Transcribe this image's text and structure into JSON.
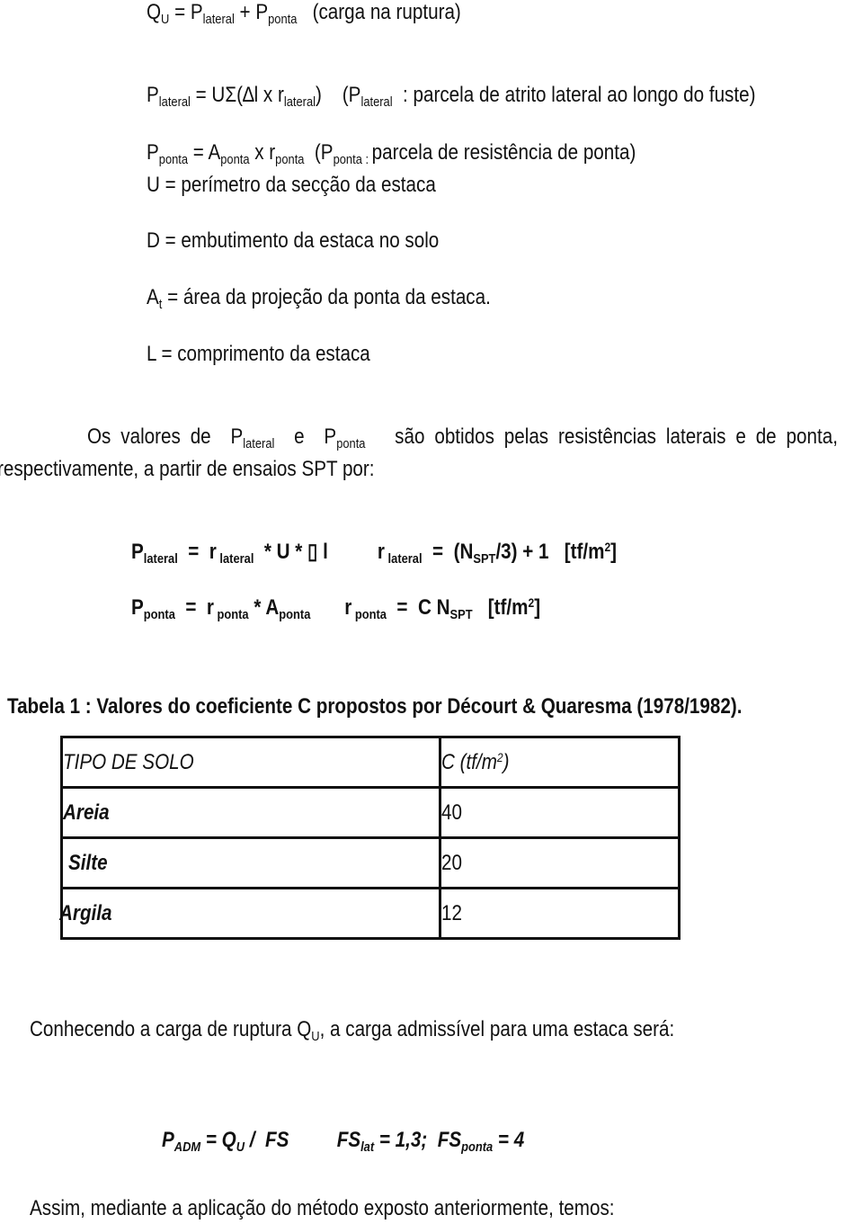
{
  "lines": {
    "qu": {
      "lhs": "Q",
      "lhs_sub": "U",
      "eq": " = P",
      "sub1": "lateral",
      "plus": " +  P",
      "sub2": "ponta",
      "note": "   (carga na ruptura)"
    },
    "plateral": {
      "p": "P",
      "sub": "lateral",
      "eq": " = UΣ(∆l x r",
      "sub2": "lateral",
      "close": ")",
      "open": "    (P",
      "sub3": "lateral",
      "note": "  : parcela de atrito lateral ao longo do fuste)"
    },
    "pponta": {
      "p": "P",
      "sub": "ponta",
      "eq": " = A",
      "sub2": "ponta",
      "x": " x r",
      "sub3": "ponta",
      "open": "  (P",
      "sub4": "ponta : ",
      "note": "parcela de resistência de ponta)"
    },
    "u_def": "U = perímetro da secção da estaca",
    "d_def": "D = embutimento da estaca no solo",
    "at_def": {
      "a": "A",
      "sub": "t",
      "text": " = área da projeção da ponta da estaca."
    },
    "l_def": "L = comprimento da estaca",
    "para1": {
      "start": "Os valores de  P",
      "sub1": "lateral",
      "mid": "  e  P",
      "sub2": "ponta",
      "end": "   são obtidos pelas resistências laterais e de ponta,"
    },
    "para2": "respectivamente, a partir de ensaios SPT por:"
  },
  "formulas": {
    "f1": {
      "p": "P",
      "psub": "lateral",
      "eq": "  =  r",
      "rsub": " lateral",
      "rest": "  * U * ▯ l",
      "r2": "r",
      "r2sub": " lateral",
      "eq2": "  =  (N",
      "nsub": "SPT",
      "tail": "/3) + 1   [tf/m",
      "sup": "2",
      "end": "]"
    },
    "f2": {
      "p": "P",
      "psub": "ponta",
      "eq": "  =  r",
      "rsub": " ponta",
      "rest": " * A",
      "asub": "ponta",
      "r2": "r",
      "r2sub": " ponta",
      "eq2": "  =  C N",
      "nsub": "SPT",
      "tail": "   [tf/m",
      "sup": "2",
      "end": "]"
    }
  },
  "table": {
    "caption": "Tabela 1 : Valores do coeficiente C propostos por Décourt & Quaresma (1978/1982).",
    "headers": {
      "col1": "TIPO DE SOLO",
      "col2": "C (tf/m",
      "col2_sup": "2",
      "col2_end": ")"
    },
    "rows": [
      {
        "solo": "Areia",
        "c": "40"
      },
      {
        "solo": "Silte",
        "c": "20"
      },
      {
        "solo": "Argila",
        "c": "12"
      }
    ]
  },
  "conclusion": {
    "text1": "Conhecendo a carga de ruptura Q",
    "text1_sub": "U",
    "text1_end": ", a carga admissível para uma estaca será:",
    "padm": {
      "p": "P",
      "psub": "ADM",
      "eq": " = Q",
      "qsub": "U",
      "rest": " /  FS",
      "fs": "FS",
      "fssub": "lat",
      "fsval": " = 1,3;  FS",
      "fssub2": "ponta",
      "fsend": " = 4"
    },
    "text2": "Assim, mediante a aplicação do método exposto anteriormente, temos:"
  }
}
